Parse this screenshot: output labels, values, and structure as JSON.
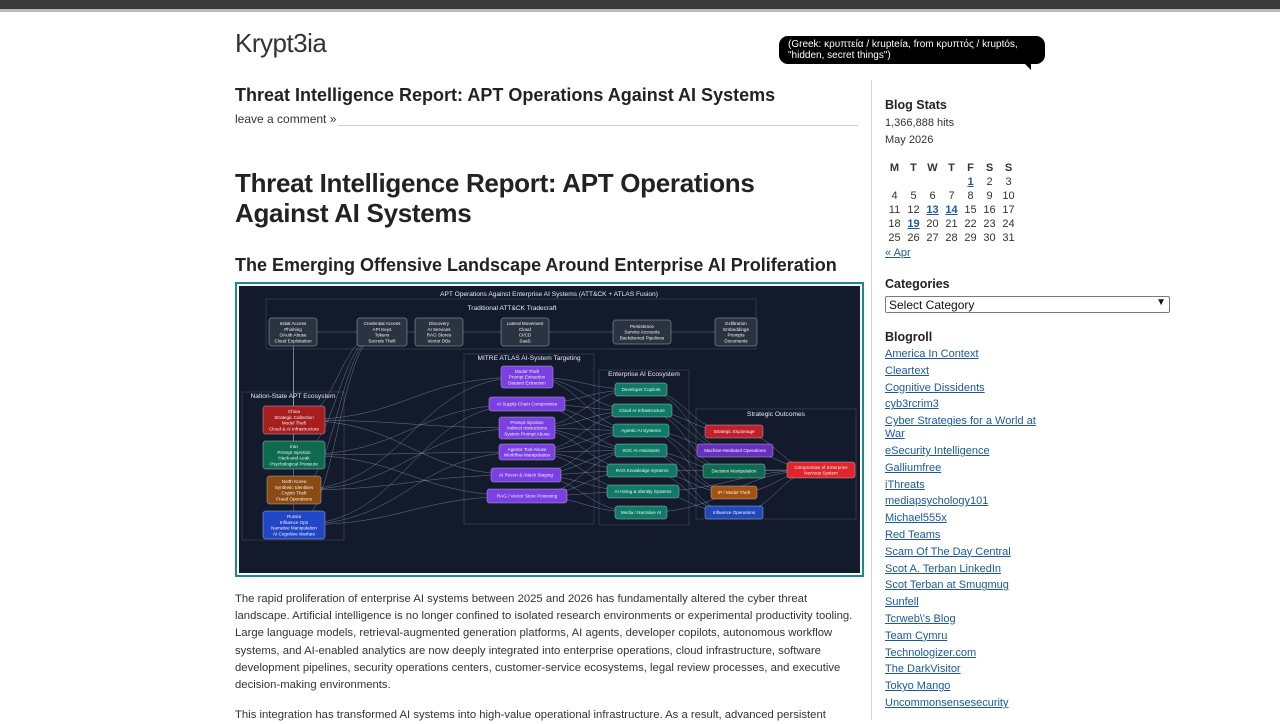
{
  "site": {
    "title": "Krypt3ia",
    "tagline": "(Greek: κρυπτεία / krupteía, from κρυπτός / kruptós, \"hidden, secret things\")"
  },
  "post": {
    "title": "Threat Intelligence Report: APT Operations Against AI Systems",
    "comments_link": "leave a comment »",
    "h1": "Threat Intelligence Report: APT Operations Against AI Systems",
    "h2": "The Emerging Offensive Landscape Around Enterprise AI Proliferation",
    "para1": "The rapid proliferation of enterprise AI systems between 2025 and 2026 has fundamentally altered the cyber threat landscape. Artificial intelligence is no longer confined to isolated research environments or experimental productivity tooling. Large language models, retrieval-augmented generation platforms, AI agents, developer copilots, autonomous workflow systems, and AI-enabled analytics are now deeply integrated into enterprise operations, cloud infrastructure, software development pipelines, security operations centers, customer-service ecosystems, legal review processes, and executive decision-making environments.",
    "para2": "This integration has transformed AI systems into high-value operational infrastructure. As a result, advanced persistent"
  },
  "diagram": {
    "title": "APT Operations Against Enterprise AI Systems (ATT&CK + ATLAS Fusion)",
    "groups": {
      "attck": "Traditional ATT&CK Tradecraft",
      "atlas": "MITRE ATLAS AI-System Targeting",
      "enterprise": "Enterprise AI Ecosystem",
      "apt": "Nation-State APT Ecosystem",
      "outcomes": "Strategic Outcomes"
    },
    "attck_nodes": [
      [
        "Initial Access",
        "Phishing",
        "OAuth Abuse",
        "Cloud Exploitation"
      ],
      [
        "Credential Access",
        "API Keys",
        "Tokens",
        "Secrets Theft"
      ],
      [
        "Discovery",
        "AI Services",
        "RAG Stores",
        "Vector DBs"
      ],
      [
        "Lateral Movement",
        "Cloud",
        "CI/CD",
        "SaaS"
      ],
      [
        "Persistence",
        "Service Accounts",
        "Backdoored Pipelines"
      ],
      [
        "Exfiltration",
        "Embeddings",
        "Prompts",
        "Documents"
      ]
    ],
    "atlas_nodes": [
      [
        "Model Theft",
        "Prompt Extraction",
        "Dataset Extraction"
      ],
      [
        "AI Supply-Chain Compromise"
      ],
      [
        "Prompt Injection",
        "Indirect Instructions",
        "System Prompt Abuse"
      ],
      [
        "Agentic Tool Abuse",
        "Workflow Manipulation"
      ],
      [
        "AI Recon & Attack Staging"
      ],
      [
        "RAG / Vector Store Poisoning"
      ]
    ],
    "enterprise_nodes": [
      "Developer Copilots",
      "Cloud AI Infrastructure",
      "Agentic AI Systems",
      "SOC AI Assistants",
      "RAG Knowledge Systems",
      "AI Hiring & Identity Systems",
      "Media / Narrative AI"
    ],
    "apt_nodes": [
      [
        "China",
        "Strategic Collection",
        "Model Theft",
        "Cloud & AI Infrastructure"
      ],
      [
        "Iran",
        "Prompt Injection",
        "Hack-and-Leak",
        "Psychological Pressure"
      ],
      [
        "North Korea",
        "Synthetic Identities",
        "Crypto Theft",
        "Fraud Operations"
      ],
      [
        "Russia",
        "Influence Ops",
        "Narrative Manipulation",
        "AI Cognitive Warfare"
      ]
    ],
    "outcome_nodes": [
      "Strategic Espionage",
      "Machine-Mediated Operations",
      "Decision Manipulation",
      "IP / Model Theft",
      "Influence Operations",
      "Compromise of Enterprise Nervous System"
    ],
    "colors": {
      "background": "#121a2c",
      "attck": "#2b3340",
      "atlas": "#7b3fe4",
      "enterprise": "#0f7a66",
      "china": "#a61e1e",
      "iran": "#0f6b50",
      "north_korea": "#8a4a10",
      "russia": "#2146c7",
      "espionage": "#c0202a",
      "machine": "#6a2fc0",
      "decision": "#0f6b50",
      "ip": "#a4520e",
      "influence": "#1f49b8",
      "compromise": "#e0262b"
    }
  },
  "sidebar": {
    "stats_heading": "Blog Stats",
    "hits": "1,366,888 hits",
    "month": "May 2026",
    "days": [
      "M",
      "T",
      "W",
      "T",
      "F",
      "S",
      "S"
    ],
    "weeks": [
      [
        "",
        "",
        "",
        "",
        "1",
        "2",
        "3"
      ],
      [
        "4",
        "5",
        "6",
        "7",
        "8",
        "9",
        "10"
      ],
      [
        "11",
        "12",
        "13",
        "14",
        "15",
        "16",
        "17"
      ],
      [
        "18",
        "19",
        "20",
        "21",
        "22",
        "23",
        "24"
      ],
      [
        "25",
        "26",
        "27",
        "28",
        "29",
        "30",
        "31"
      ]
    ],
    "linked_days": [
      "1",
      "13",
      "14",
      "19"
    ],
    "prev_month": "« Apr",
    "categories_heading": "Categories",
    "categories_select": "Select Category",
    "blogroll_heading": "Blogroll",
    "blogroll": [
      "America In Context",
      "Cleartext",
      "Cognitive Dissidents",
      "cyb3rcrim3",
      "Cyber Strategies for a World at War",
      "eSecurity Intelligence",
      "Galliumfree",
      "iThreats",
      "mediapsychology101",
      "Michael555x",
      "Red Teams",
      "Scam Of The Day Central",
      "Scot A. Terban LinkedIn",
      "Scot Terban at Smugmug",
      "Sunfell",
      "Tcrweb\\'s Blog",
      "Team Cymru",
      "Technologizer.com",
      "The DarkVisitor",
      "Tokyo Mango",
      "Uncommonsensesecurity"
    ]
  }
}
